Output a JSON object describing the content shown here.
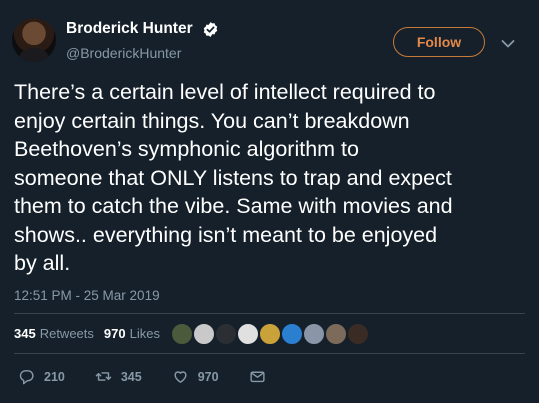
{
  "user": {
    "name": "Broderick Hunter",
    "handle": "@BroderickHunter",
    "follow_label": "Follow"
  },
  "tweet": {
    "text": "There’s a certain level of intellect required to\nenjoy certain things. You can’t breakdown\nBeethoven’s symphonic algorithm to\nsomeone that ONLY listens to trap and expect\nthem to catch the vibe. Same with movies and\nshows.. everything isn’t meant to be enjoyed\nby all.",
    "timestamp": "12:51 PM - 25 Mar 2019"
  },
  "stats": {
    "retweets_count": "345",
    "retweets_label": "Retweets",
    "likes_count": "970",
    "likes_label": "Likes"
  },
  "liker_avatars": [
    {
      "icon": "avatar-1",
      "color": "#4a5a3a"
    },
    {
      "icon": "avatar-2",
      "color": "#c9c9c9"
    },
    {
      "icon": "avatar-3",
      "color": "#2b2f33"
    },
    {
      "icon": "avatar-4",
      "color": "#e0e0e0"
    },
    {
      "icon": "avatar-5",
      "color": "#c9a23a"
    },
    {
      "icon": "avatar-6",
      "color": "#2a7fd1"
    },
    {
      "icon": "avatar-7",
      "color": "#8a96a8"
    },
    {
      "icon": "avatar-8",
      "color": "#7c6a5a"
    },
    {
      "icon": "avatar-9",
      "color": "#3a2c24"
    }
  ],
  "actions": {
    "replies": "210",
    "retweets": "345",
    "likes": "970"
  },
  "colors": {
    "background": "#15202b",
    "accent": "#e5894a",
    "muted": "#8899a6",
    "verified": "#ffffff"
  }
}
